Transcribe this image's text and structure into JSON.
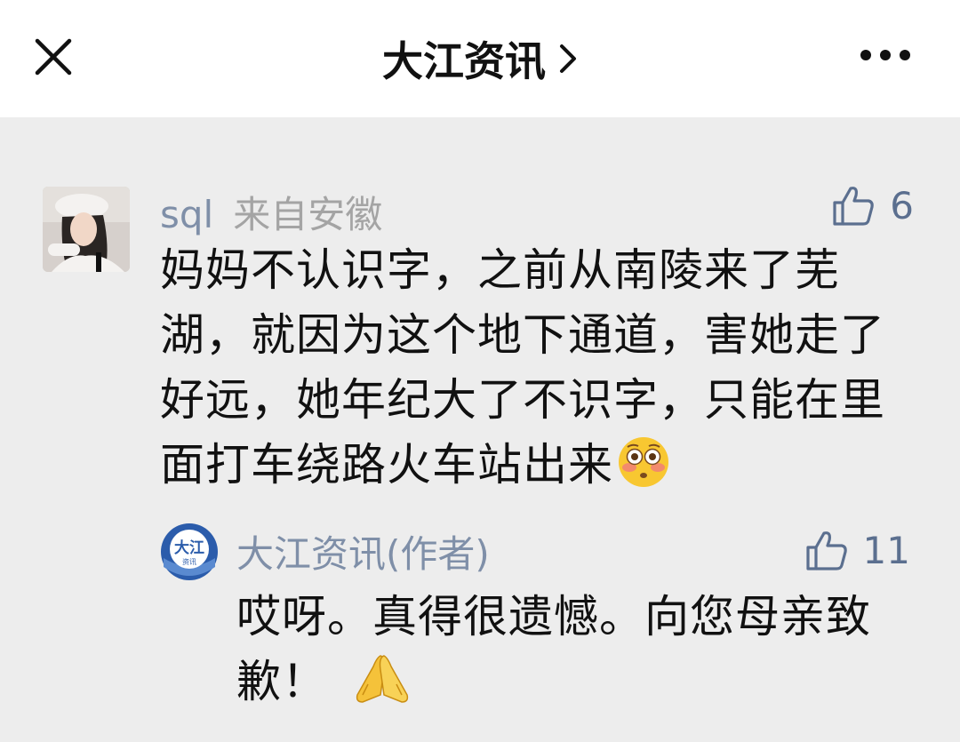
{
  "header": {
    "title": "大江资讯",
    "close_icon": "close-icon",
    "chevron_icon": "chevron-right-icon",
    "more_icon": "more-horizontal-icon"
  },
  "comment": {
    "username": "sql",
    "location": "来自安徽",
    "likes": "6",
    "text": "妈妈不认识字，之前从南陵来了芜湖，就因为这个地下通道，害她走了好远，她年纪大了不识字，只能在里面打车绕路火车站出来",
    "emoji": "flushed-face-emoji",
    "avatar": "user-avatar"
  },
  "reply": {
    "author": "大江资讯(作者)",
    "likes": "11",
    "text": "哎呀。真得很遗憾。向您母亲致歉！",
    "emoji": "folded-hands-emoji",
    "avatar": "dajiang-logo",
    "logo_text_main": "大江",
    "logo_text_sub": "资讯"
  },
  "colors": {
    "background": "#ededed",
    "header_bg": "#ffffff",
    "name_color": "#7f8fa8",
    "like_color": "#5b6f8f",
    "text_color": "#111111",
    "logo_blue": "#2b5cab"
  }
}
